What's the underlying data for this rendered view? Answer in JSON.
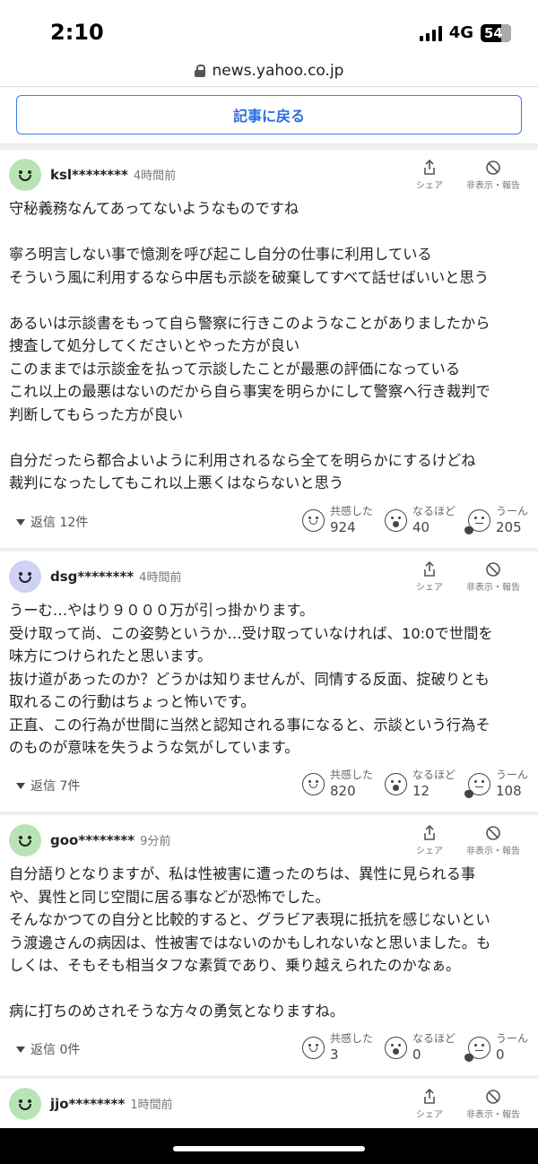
{
  "status": {
    "time": "2:10",
    "network": "4G",
    "battery": "54"
  },
  "browser": {
    "url": "news.yahoo.co.jp"
  },
  "back_button": {
    "label": "記事に戻る"
  },
  "actions": {
    "share": "シェア",
    "hide": "非表示・報告"
  },
  "reaction_labels": {
    "empathy": "共感した",
    "naruhodo": "なるほど",
    "uun": "うーん"
  },
  "comments": [
    {
      "user": "ksl********",
      "time": "4時間前",
      "lines": [
        "守秘義務なんてあってないようなものですね",
        "",
        "寧ろ明言しない事で憶測を呼び起こし自分の仕事に利用している",
        "そういう風に利用するなら中居も示談を破棄してすべて話せばいいと思う",
        "",
        "あるいは示談書をもって自ら警察に行きこのようなことがありましたから",
        "捜査して処分してくださいとやった方が良い",
        "このままでは示談金を払って示談したことが最悪の評価になっている",
        "これ以上の最悪はないのだから自ら事実を明らかにして警察へ行き裁判で",
        "判断してもらった方が良い",
        "",
        "自分だったら都合よいように利用されるなら全てを明らかにするけどね",
        "裁判になったしてもこれ以上悪くはならないと思う"
      ],
      "replies": "返信 12件",
      "empathy": "924",
      "naruhodo": "40",
      "uun": "205"
    },
    {
      "user": "dsg********",
      "time": "4時間前",
      "lines": [
        "うーむ…やはり９０００万が引っ掛かります。",
        "受け取って尚、この姿勢というか…受け取っていなければ、10:0で世間を",
        "味方につけられたと思います。",
        "抜け道があったのか？どうかは知りませんが、同情する反面、掟破りとも",
        "取れるこの行動はちょっと怖いです。",
        "正直、この行為が世間に当然と認知される事になると、示談という行為そ",
        "のものが意味を失うような気がしています。"
      ],
      "replies": "返信 7件",
      "empathy": "820",
      "naruhodo": "12",
      "uun": "108"
    },
    {
      "user": "goo********",
      "time": "9分前",
      "lines": [
        "自分語りとなりますが、私は性被害に遭ったのちは、異性に見られる事",
        "や、異性と同じ空間に居る事などが恐怖でした。",
        "そんなかつての自分と比較的すると、グラビア表現に抵抗を感じないとい",
        "う渡邊さんの病因は、性被害ではないのかもしれないなと思いました。も",
        "しくは、そもそも相当タフな素質であり、乗り越えられたのかなぁ。",
        "",
        "病に打ちのめされそうな方々の勇気となりますね。"
      ],
      "replies": "返信 0件",
      "empathy": "3",
      "naruhodo": "0",
      "uun": "0"
    },
    {
      "user": "jjo********",
      "time": "1時間前"
    }
  ]
}
